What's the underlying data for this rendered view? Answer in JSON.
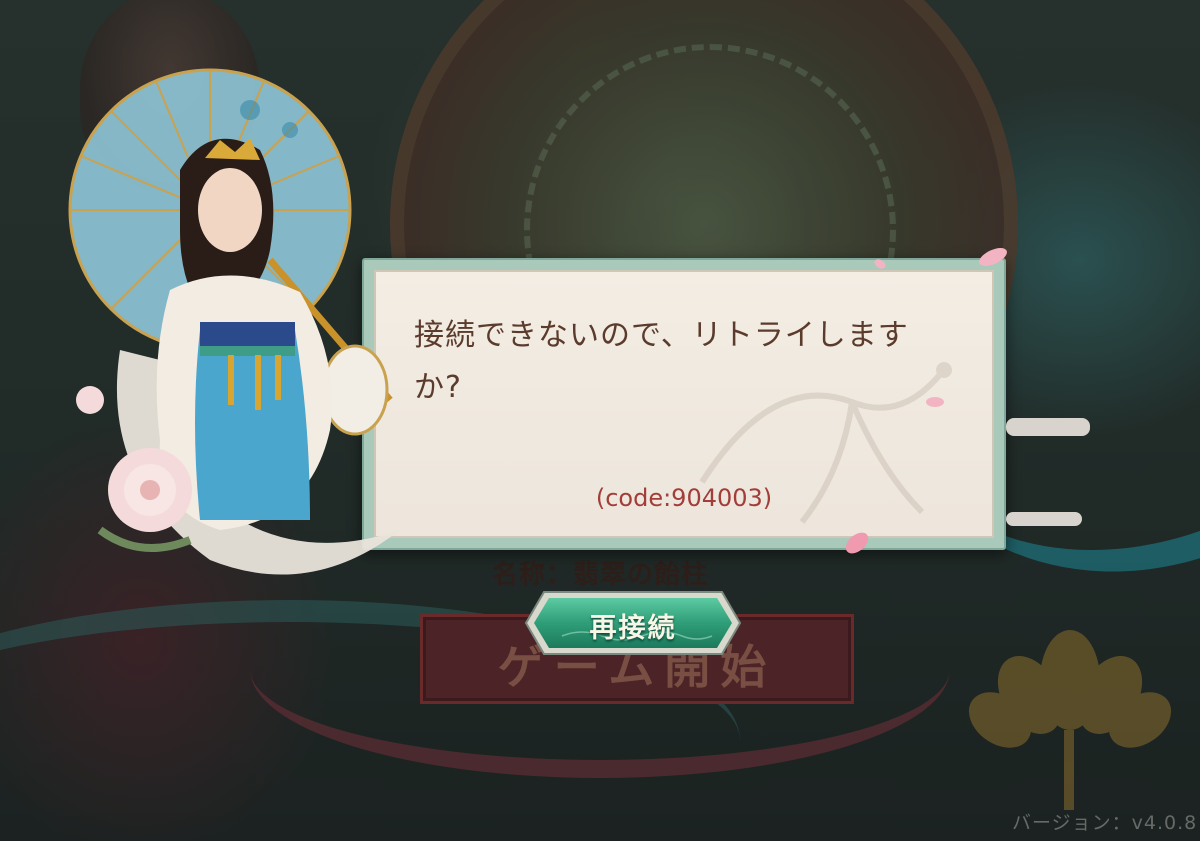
{
  "dialog": {
    "message_line1": "接続できないので、リトライします",
    "message_line2": "か?",
    "error_code": "(code:904003)"
  },
  "reconnect_button": {
    "label": "再接続"
  },
  "server": {
    "label": "名称：",
    "name": "翡翠の飴柱"
  },
  "start_button": {
    "label": "ゲーム開始"
  },
  "version": {
    "label": "バージョン：",
    "value": "v4.0.8"
  },
  "colors": {
    "dialog_frame": "#a9c9bb",
    "dialog_paper": "#f3ede4",
    "message_text": "#5b3b2c",
    "code_text": "#a23d3a",
    "button_green": "#2f9e78"
  }
}
